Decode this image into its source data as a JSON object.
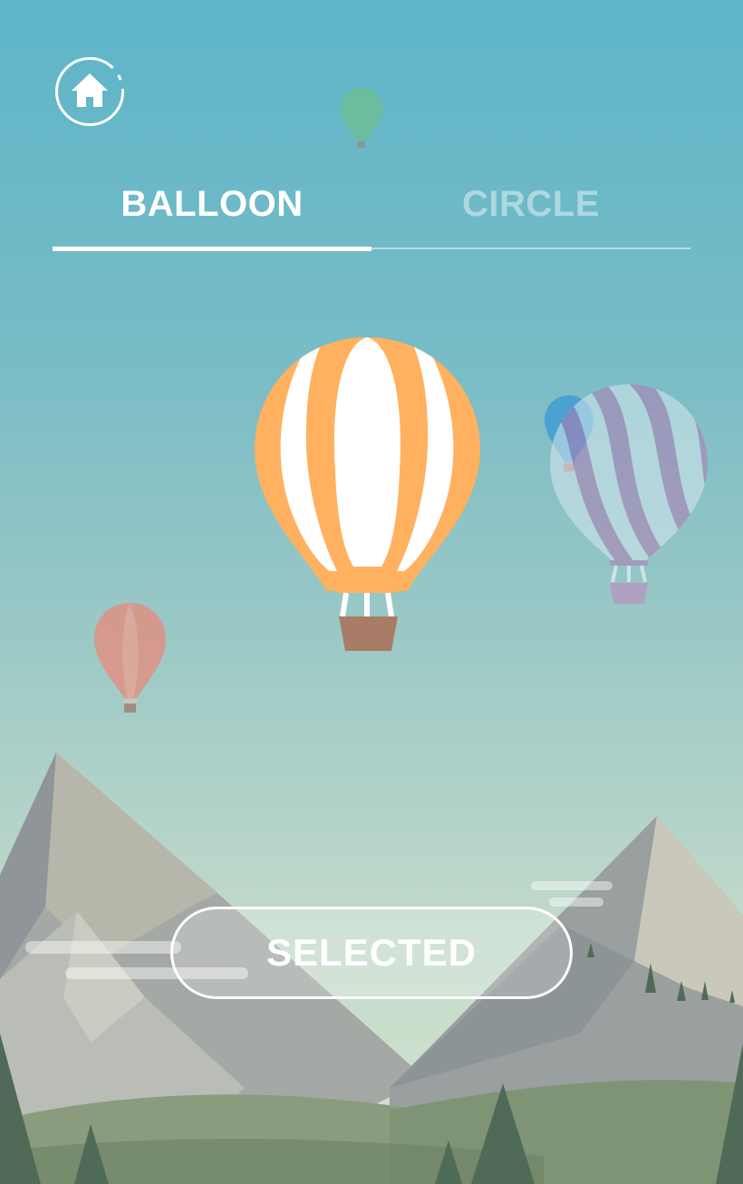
{
  "header": {
    "home_icon": "home-icon"
  },
  "tabs": [
    {
      "label": "BALLOON",
      "active": true
    },
    {
      "label": "CIRCLE",
      "active": false
    }
  ],
  "select_button": {
    "label": "SELECTED"
  },
  "colors": {
    "sky_top": "#5db5c9",
    "balloon_orange": "#ffb15f",
    "balloon_stripe": "#ffffff",
    "basket": "#a97c66"
  }
}
